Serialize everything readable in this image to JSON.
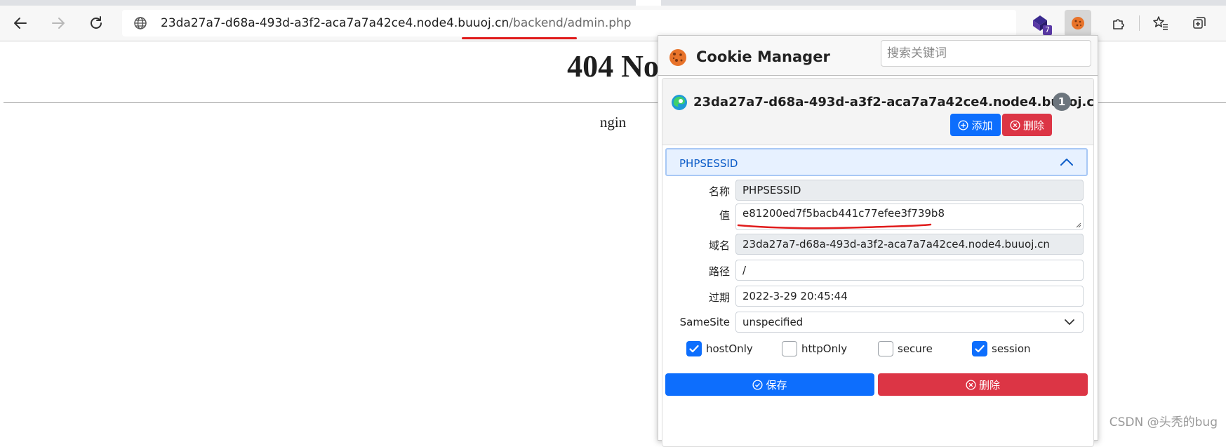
{
  "browser": {
    "url_host": "23da27a7-d68a-493d-a3f2-aca7a7a42ce4.node4.buuoj.cn",
    "url_path": "/backend/admin.php",
    "extension_badge": "7",
    "icons": [
      "back-icon",
      "forward-icon",
      "refresh-icon",
      "globe-icon",
      "extension-icon",
      "cookie-icon",
      "puzzle-icon",
      "favorites-icon",
      "collections-icon"
    ]
  },
  "page": {
    "heading": "404 No",
    "server": "ngin"
  },
  "cookie_manager": {
    "title": "Cookie Manager",
    "search_placeholder": "搜索关键词",
    "domain": "23da27a7-d68a-493d-a3f2-aca7a7a42ce4.node4.buuoj.cn",
    "count": "1",
    "add_label": "添加",
    "delete_label": "删除",
    "cookie": {
      "name_header": "PHPSESSID",
      "labels": {
        "name": "名称",
        "value": "值",
        "domain": "域名",
        "path": "路径",
        "expires": "过期",
        "samesite": "SameSite"
      },
      "name": "PHPSESSID",
      "value": "e81200ed7f5bacb441c77efee3f739b8",
      "domain": "23da27a7-d68a-493d-a3f2-aca7a7a42ce4.node4.buuoj.cn",
      "path": "/",
      "expires": "2022-3-29 20:45:44",
      "samesite": "unspecified",
      "flags": [
        {
          "label": "hostOnly",
          "checked": true
        },
        {
          "label": "httpOnly",
          "checked": false
        },
        {
          "label": "secure",
          "checked": false
        },
        {
          "label": "session",
          "checked": true
        }
      ],
      "save_label": "保存",
      "delete_label": "删除"
    }
  },
  "watermark": "CSDN @头秃的bug",
  "colors": {
    "primary": "#0d6efd",
    "danger": "#dc3545",
    "annotation_red": "#e01b1b"
  }
}
